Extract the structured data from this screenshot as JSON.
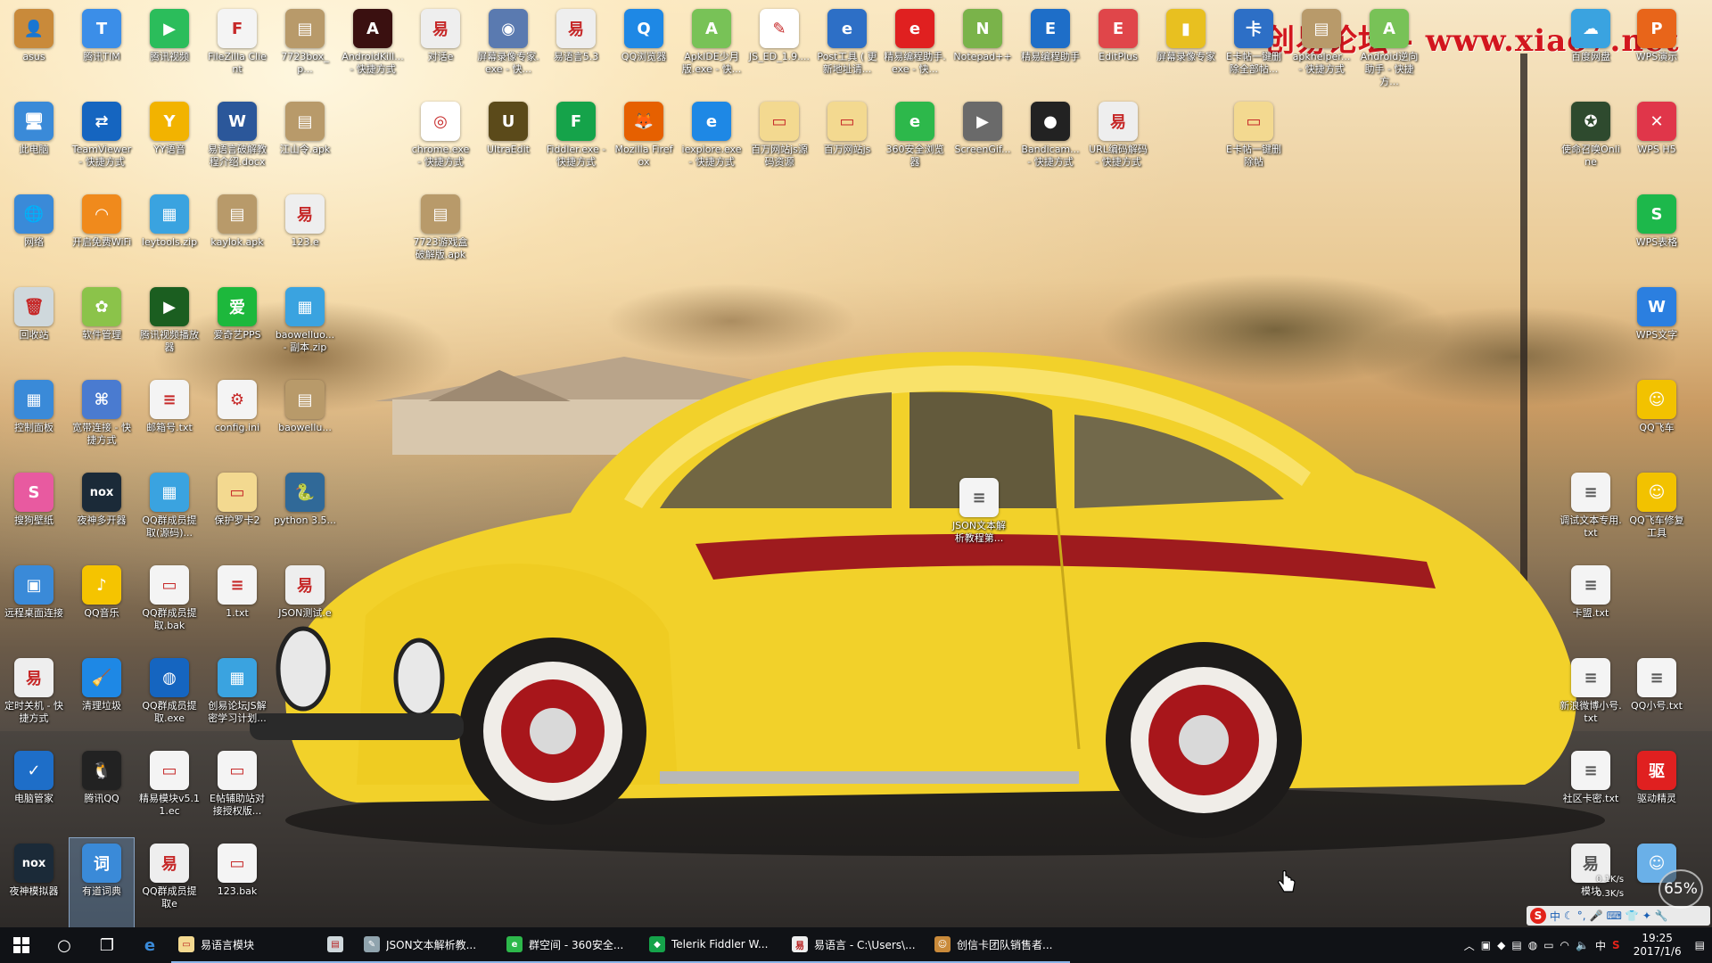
{
  "watermark": "创易论坛 - www.xiao7.net",
  "desktop_icons": [
    {
      "label": "asus",
      "color": "#c98a3a",
      "glyph": "👤"
    },
    {
      "label": "腾讯TIM",
      "color": "#3b8ee8",
      "glyph": "T"
    },
    {
      "label": "腾讯视频",
      "color": "#2bbd5b",
      "glyph": "▶"
    },
    {
      "label": "FileZilla Client",
      "color": "#f4f4f4",
      "glyph": "F",
      "dark": true
    },
    {
      "label": "7723box_p...",
      "color": "#b89a6a",
      "glyph": "▤"
    },
    {
      "label": "AndroidKill... - 快捷方式",
      "color": "#3a1010",
      "glyph": "A"
    },
    {
      "label": "对话e",
      "color": "#eee",
      "glyph": "易",
      "dark": true
    },
    {
      "label": "屏幕录像专家.exe - 快...",
      "color": "#5a7ab0",
      "glyph": "◉"
    },
    {
      "label": "易语言5.3",
      "color": "#eee",
      "glyph": "易",
      "dark": true
    },
    {
      "label": "QQ浏览器",
      "color": "#1e88e5",
      "glyph": "Q"
    },
    {
      "label": "ApkIDE少月版.exe - 快...",
      "color": "#78c257",
      "glyph": "A"
    },
    {
      "label": "JS_ED_1.9....",
      "color": "#fff",
      "glyph": "✎",
      "dark": true
    },
    {
      "label": "Post工具 ( 更新地址请...",
      "color": "#2d6fc6",
      "glyph": "e"
    },
    {
      "label": "精易编程助手.exe - 快...",
      "color": "#e02020",
      "glyph": "e"
    },
    {
      "label": "Notepad++",
      "color": "#7ab34a",
      "glyph": "N"
    },
    {
      "label": "精易编程助手",
      "color": "#1e6ec8",
      "glyph": "E"
    },
    {
      "label": "EditPlus",
      "color": "#e0464a",
      "glyph": "E"
    },
    {
      "label": "屏幕录像专家",
      "color": "#e8c020",
      "glyph": "▮"
    },
    {
      "label": "E卡帖一键删除全部帖...",
      "color": "#2d6fc6",
      "glyph": "卡"
    },
    {
      "label": "apkhelper... - 快捷方式",
      "color": "#b89a6a",
      "glyph": "▤"
    },
    {
      "label": "Android逆向助手 - 快捷方...",
      "color": "#78c257",
      "glyph": "A"
    },
    {
      "label": "此电脑",
      "color": "#3a8ad8",
      "glyph": "🖥"
    },
    {
      "label": "TeamViewer - 快捷方式",
      "color": "#1565c0",
      "glyph": "⇄"
    },
    {
      "label": "YY语音",
      "color": "#f2b300",
      "glyph": "Y"
    },
    {
      "label": "易语言破解教程介绍.docx",
      "color": "#2b579a",
      "glyph": "W"
    },
    {
      "label": "江山令.apk",
      "color": "#b89a6a",
      "glyph": "▤"
    },
    {
      "label": "chrome.exe - 快捷方式",
      "color": "#ffffff",
      "glyph": "◎",
      "dark": true
    },
    {
      "label": "UltraEdit",
      "color": "#5b4a1a",
      "glyph": "U"
    },
    {
      "label": "Fiddler.exe - 快捷方式",
      "color": "#15a34a",
      "glyph": "F"
    },
    {
      "label": "Mozilla Firefox",
      "color": "#e66000",
      "glyph": "🦊"
    },
    {
      "label": "iexplore.exe - 快捷方式",
      "color": "#1e88e5",
      "glyph": "e"
    },
    {
      "label": "百万网站js源码资源",
      "color": "#f3d990",
      "glyph": "▭",
      "dark": true
    },
    {
      "label": "百万网站js",
      "color": "#f3d990",
      "glyph": "▭",
      "dark": true
    },
    {
      "label": "360安全浏览器",
      "color": "#2db84b",
      "glyph": "e"
    },
    {
      "label": "ScreenGif...",
      "color": "#6a6a6a",
      "glyph": "▶"
    },
    {
      "label": "Bandicam... - 快捷方式",
      "color": "#222",
      "glyph": "●"
    },
    {
      "label": "URL编码解码 - 快捷方式",
      "color": "#eee",
      "glyph": "易",
      "dark": true
    },
    {
      "label": "E卡帖一键删除帖",
      "color": "#f3d990",
      "glyph": "▭",
      "dark": true
    },
    {
      "label": "网络",
      "color": "#3a8ad8",
      "glyph": "🌐"
    },
    {
      "label": "开启免费WiFi",
      "color": "#f08a1c",
      "glyph": "◠"
    },
    {
      "label": "leytools.zip",
      "color": "#3aa3e0",
      "glyph": "▦"
    },
    {
      "label": "kaylok.apk",
      "color": "#b89a6a",
      "glyph": "▤"
    },
    {
      "label": "123.e",
      "color": "#eee",
      "glyph": "易",
      "dark": true
    },
    {
      "label": "7723游戏盒破解版.apk",
      "color": "#b89a6a",
      "glyph": "▤"
    },
    {
      "label": "回收站",
      "color": "#cfd8dc",
      "glyph": "🗑",
      "dark": true
    },
    {
      "label": "软件管理",
      "color": "#8bc34a",
      "glyph": "✿"
    },
    {
      "label": "腾讯视频播放器",
      "color": "#1b5e20",
      "glyph": "▶"
    },
    {
      "label": "爱奇艺PPS",
      "color": "#1db83c",
      "glyph": "爱"
    },
    {
      "label": "baowelluo... - 副本.zip",
      "color": "#3aa3e0",
      "glyph": "▦"
    },
    {
      "label": "控制面板",
      "color": "#3a8ad8",
      "glyph": "▦"
    },
    {
      "label": "宽带连接 - 快捷方式",
      "color": "#4a7bd0",
      "glyph": "⌘"
    },
    {
      "label": "邮箱号.txt",
      "color": "#f4f4f4",
      "glyph": "≡",
      "dark": true
    },
    {
      "label": "config.ini",
      "color": "#f4f4f4",
      "glyph": "⚙",
      "dark": true
    },
    {
      "label": "baowellu...",
      "color": "#b89a6a",
      "glyph": "▤"
    },
    {
      "label": "搜狗壁纸",
      "color": "#e85aa0",
      "glyph": "S"
    },
    {
      "label": "夜神多开器",
      "color": "#1b2a38",
      "glyph": "nox"
    },
    {
      "label": "QQ群成员提取(源码)...",
      "color": "#3aa3e0",
      "glyph": "▦"
    },
    {
      "label": "保护罗卡2",
      "color": "#f3d990",
      "glyph": "▭",
      "dark": true
    },
    {
      "label": "python 3.5...",
      "color": "#306998",
      "glyph": "🐍"
    },
    {
      "label": "远程桌面连接",
      "color": "#3a8ad8",
      "glyph": "▣"
    },
    {
      "label": "QQ音乐",
      "color": "#f5c400",
      "glyph": "♪"
    },
    {
      "label": "QQ群成员提取.bak",
      "color": "#f4f4f4",
      "glyph": "▭",
      "dark": true
    },
    {
      "label": "1.txt",
      "color": "#f4f4f4",
      "glyph": "≡",
      "dark": true
    },
    {
      "label": "JSON测试.e",
      "color": "#eee",
      "glyph": "易",
      "dark": true
    },
    {
      "label": "定时关机 - 快捷方式",
      "color": "#eee",
      "glyph": "易",
      "dark": true
    },
    {
      "label": "清理垃圾",
      "color": "#1e88e5",
      "glyph": "🧹"
    },
    {
      "label": "QQ群成员提取.exe",
      "color": "#1565c0",
      "glyph": "◍"
    },
    {
      "label": "创易论坛JS解密学习计划...",
      "color": "#3aa3e0",
      "glyph": "▦"
    },
    {
      "label": "电脑管家",
      "color": "#1e6ec8",
      "glyph": "✓"
    },
    {
      "label": "腾讯QQ",
      "color": "#222",
      "glyph": "🐧"
    },
    {
      "label": "精易模块v5.11.ec",
      "color": "#f4f4f4",
      "glyph": "▭",
      "dark": true
    },
    {
      "label": "E帖辅助站对接授权版...",
      "color": "#f4f4f4",
      "glyph": "▭",
      "dark": true
    },
    {
      "label": "夜神模拟器",
      "color": "#1b2a38",
      "glyph": "nox"
    },
    {
      "label": "有道词典",
      "color": "#3a8ad8",
      "glyph": "词"
    },
    {
      "label": "QQ群成员提取e",
      "color": "#eee",
      "glyph": "易",
      "dark": true
    },
    {
      "label": "123.bak",
      "color": "#f4f4f4",
      "glyph": "▭",
      "dark": true
    }
  ],
  "right_icons": [
    {
      "label": "百度网盘",
      "color": "#3aa3e0",
      "glyph": "☁"
    },
    {
      "label": "WPS演示",
      "color": "#e8651a",
      "glyph": "P"
    },
    {
      "label": "使命召唤Online",
      "color": "#2e4a2e",
      "glyph": "✪"
    },
    {
      "label": "WPS H5",
      "color": "#e0364a",
      "glyph": "✕"
    },
    {
      "label": "WPS表格",
      "color": "#1db84b",
      "glyph": "S"
    },
    {
      "label": "WPS文字",
      "color": "#2b7fe0",
      "glyph": "W"
    },
    {
      "label": "QQ飞车",
      "color": "#f2c200",
      "glyph": "☺"
    },
    {
      "label": "调试文本专用.txt",
      "color": "#f4f4f4",
      "glyph": "≡",
      "dark": true
    },
    {
      "label": "QQ飞车修复工具",
      "color": "#f2c200",
      "glyph": "☺"
    },
    {
      "label": "卡盟.txt",
      "color": "#f4f4f4",
      "glyph": "≡",
      "dark": true
    },
    {
      "label": "新浪微博小号.txt",
      "color": "#f4f4f4",
      "glyph": "≡",
      "dark": true
    },
    {
      "label": "QQ小号.txt",
      "color": "#f4f4f4",
      "glyph": "≡",
      "dark": true
    },
    {
      "label": "社区卡密.txt",
      "color": "#f4f4f4",
      "glyph": "≡",
      "dark": true
    },
    {
      "label": "驱动精灵",
      "color": "#e02020",
      "glyph": "驱"
    },
    {
      "label": "模块",
      "color": "#eee",
      "glyph": "易",
      "dark": true
    },
    {
      "label": "",
      "color": "#6ab0e8",
      "glyph": "☺"
    }
  ],
  "floating_file": {
    "label": "JSON文本解析教程第..."
  },
  "net_meter": {
    "up": "0.1K/s",
    "down": "0.3K/s",
    "percent": "65%"
  },
  "ime": {
    "logo": "S",
    "lang": "中"
  },
  "taskbar": {
    "tasks": [
      {
        "label": "易语言模块",
        "color": "#f3d990",
        "glyph": "▭"
      },
      {
        "label": "",
        "color": "#cfd8dc",
        "glyph": "▤"
      },
      {
        "label": "JSON文本解析教...",
        "color": "#90a4ae",
        "glyph": "✎"
      },
      {
        "label": "群空间 - 360安全...",
        "color": "#2db84b",
        "glyph": "e"
      },
      {
        "label": "Telerik Fiddler W...",
        "color": "#15a34a",
        "glyph": "◆"
      },
      {
        "label": "易语言 - C:\\Users\\...",
        "color": "#eee",
        "glyph": "易"
      },
      {
        "label": "创信卡团队销售者...",
        "color": "#c98a3a",
        "glyph": "☺"
      }
    ],
    "tray_lang": "中",
    "time": "19:25",
    "date": "2017/1/6"
  }
}
